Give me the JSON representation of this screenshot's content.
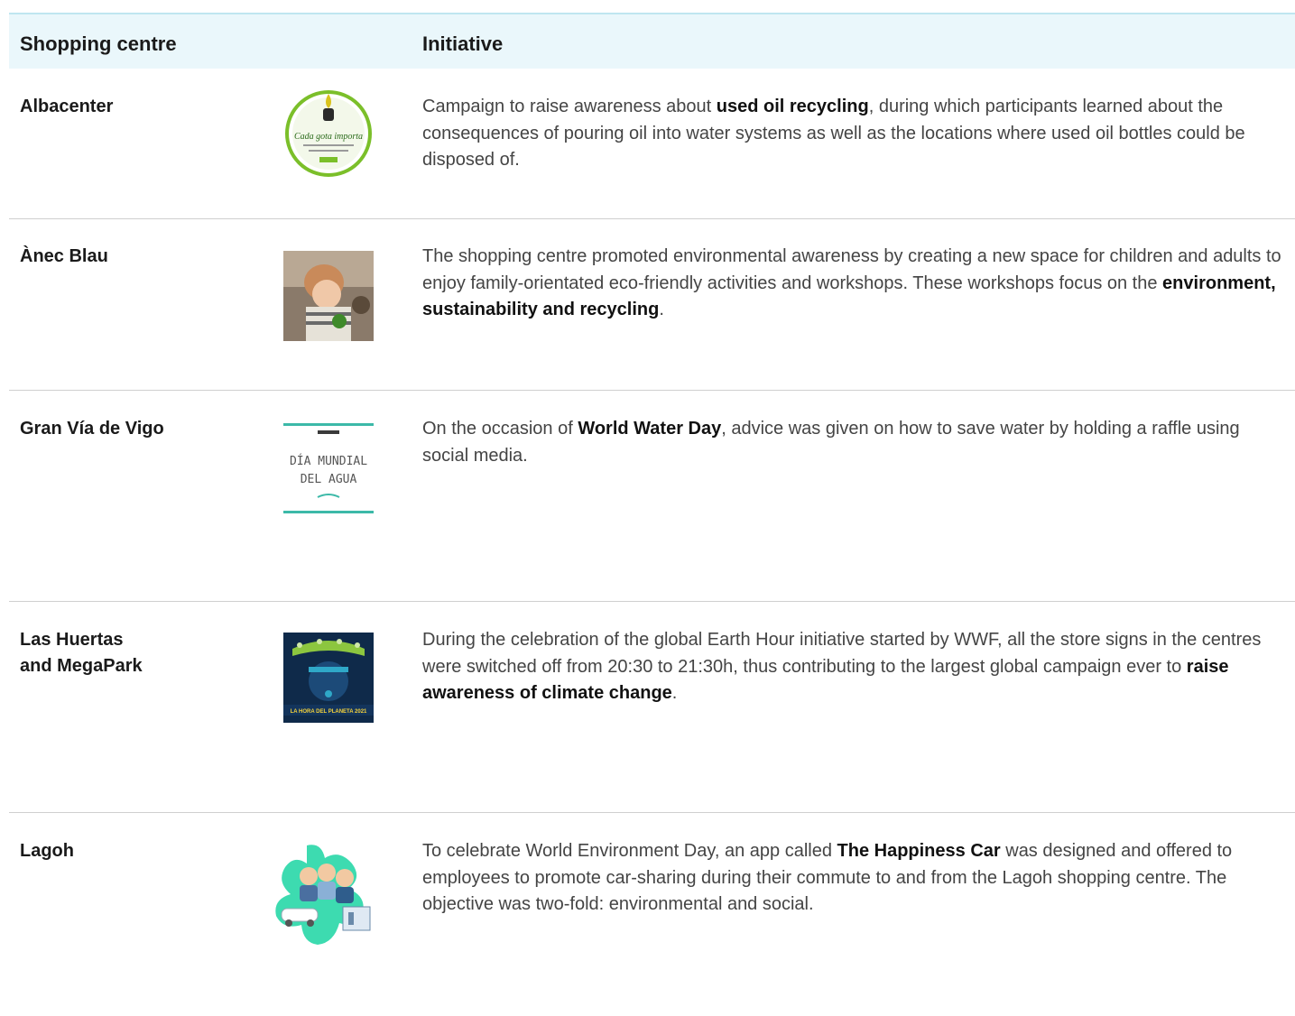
{
  "header": {
    "col1": "Shopping centre",
    "col2": "Initiative"
  },
  "rows": [
    {
      "name": "Albacenter",
      "image_label": "Cada gota importa",
      "desc": {
        "pre": "Campaign to raise awareness about ",
        "bold": "used oil recycling",
        "post": ", during which participants learned about the consequences of pouring oil into water systems as well as the locations where used oil bottles could be disposed of."
      }
    },
    {
      "name": "Ànec Blau",
      "desc": {
        "pre": "The shopping centre promoted environmental awareness by creating a new space for children and adults to enjoy family-orientated eco-friendly activities and workshops. These workshops focus on the ",
        "bold": "environment, sustainability and recycling",
        "post": "."
      }
    },
    {
      "name": "Gran Vía de Vigo",
      "image_label_1": "DÍA MUNDIAL",
      "image_label_2": "DEL AGUA",
      "desc": {
        "pre": "On the occasion of ",
        "bold": "World Water Day",
        "post": ", advice was given on how to save water by holding a raffle using social media."
      }
    },
    {
      "name_1": "Las Huertas",
      "name_2": "and MegaPark",
      "image_label": "LA HORA DEL PLANETA 2021",
      "desc": {
        "pre": "During the celebration of the global Earth Hour initiative started by WWF, all the store signs in the centres were switched off from 20:30 to 21:30h, thus contributing to the largest global campaign ever to ",
        "bold": "raise awareness of climate change",
        "post": "."
      }
    },
    {
      "name": "Lagoh",
      "desc": {
        "pre": "To celebrate World Environment Day, an app called ",
        "bold": "The Happiness Car",
        "post": " was designed and offered to employees to promote car-sharing during their commute to and from the Lagoh shopping centre. The objective was two-fold: environmental and social."
      }
    }
  ],
  "colors": {
    "header_bg": "#eaf7fb",
    "divider": "#cfcfcf",
    "accent_teal": "#3cc7a8",
    "green": "#7bbf2a"
  }
}
